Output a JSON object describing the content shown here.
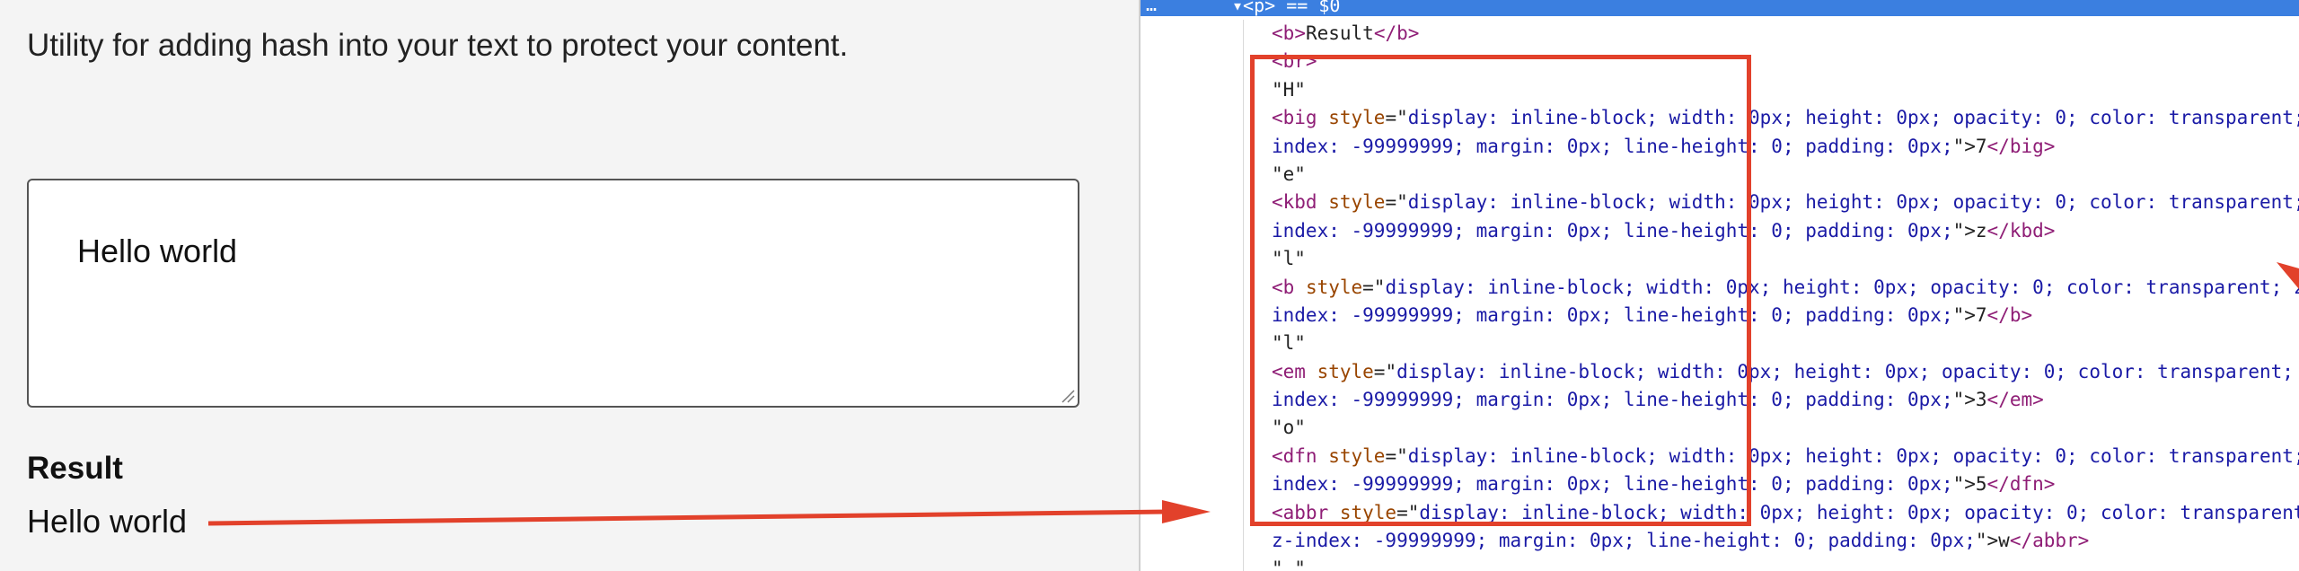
{
  "app": {
    "description": "Utility for adding hash into your text to protect your content.",
    "input_value": "Hello world",
    "result_heading": "Result",
    "result_text": "Hello world"
  },
  "devtools": {
    "ellipsis": "…",
    "selected_node": "▾<p> == $0",
    "lines": [
      [
        {
          "c": "tag",
          "t": "<"
        },
        {
          "c": "tag",
          "t": "b"
        },
        {
          "c": "tag",
          "t": ">"
        },
        {
          "c": "txt",
          "t": "Result"
        },
        {
          "c": "tag",
          "t": "</b>"
        }
      ],
      [
        {
          "c": "tag",
          "t": "<br>"
        }
      ],
      [
        {
          "c": "txt",
          "t": "\"H\""
        }
      ],
      [
        {
          "c": "tag",
          "t": "<big "
        },
        {
          "c": "attr",
          "t": "style"
        },
        {
          "c": "txt",
          "t": "=\""
        },
        {
          "c": "val",
          "t": "display: inline-block; width: 0px; height: 0px; opacity: 0; color: transparent; z-"
        }
      ],
      [
        {
          "c": "val",
          "t": "index: -99999999; margin: 0px; line-height: 0; padding: 0px;"
        },
        {
          "c": "txt",
          "t": "\">"
        },
        {
          "c": "txt",
          "t": "7"
        },
        {
          "c": "tag",
          "t": "</big>"
        }
      ],
      [
        {
          "c": "txt",
          "t": "\"e\""
        }
      ],
      [
        {
          "c": "tag",
          "t": "<kbd "
        },
        {
          "c": "attr",
          "t": "style"
        },
        {
          "c": "txt",
          "t": "=\""
        },
        {
          "c": "val",
          "t": "display: inline-block; width: 0px; height: 0px; opacity: 0; color: transparent; z-"
        }
      ],
      [
        {
          "c": "val",
          "t": "index: -99999999; margin: 0px; line-height: 0; padding: 0px;"
        },
        {
          "c": "txt",
          "t": "\">"
        },
        {
          "c": "txt",
          "t": "z"
        },
        {
          "c": "tag",
          "t": "</kbd>"
        }
      ],
      [
        {
          "c": "txt",
          "t": "\"l\""
        }
      ],
      [
        {
          "c": "tag",
          "t": "<b "
        },
        {
          "c": "attr",
          "t": "style"
        },
        {
          "c": "txt",
          "t": "=\""
        },
        {
          "c": "val",
          "t": "display: inline-block; width: 0px; height: 0px; opacity: 0; color: transparent; z-"
        }
      ],
      [
        {
          "c": "val",
          "t": "index: -99999999; margin: 0px; line-height: 0; padding: 0px;"
        },
        {
          "c": "txt",
          "t": "\">"
        },
        {
          "c": "txt",
          "t": "7"
        },
        {
          "c": "tag",
          "t": "</b>"
        }
      ],
      [
        {
          "c": "txt",
          "t": "\"l\""
        }
      ],
      [
        {
          "c": "tag",
          "t": "<em "
        },
        {
          "c": "attr",
          "t": "style"
        },
        {
          "c": "txt",
          "t": "=\""
        },
        {
          "c": "val",
          "t": "display: inline-block; width: 0px; height: 0px; opacity: 0; color: transparent; z-"
        }
      ],
      [
        {
          "c": "val",
          "t": "index: -99999999; margin: 0px; line-height: 0; padding: 0px;"
        },
        {
          "c": "txt",
          "t": "\">"
        },
        {
          "c": "txt",
          "t": "3"
        },
        {
          "c": "tag",
          "t": "</em>"
        }
      ],
      [
        {
          "c": "txt",
          "t": "\"o\""
        }
      ],
      [
        {
          "c": "tag",
          "t": "<dfn "
        },
        {
          "c": "attr",
          "t": "style"
        },
        {
          "c": "txt",
          "t": "=\""
        },
        {
          "c": "val",
          "t": "display: inline-block; width: 0px; height: 0px; opacity: 0; color: transparent; z-"
        }
      ],
      [
        {
          "c": "val",
          "t": "index: -99999999; margin: 0px; line-height: 0; padding: 0px;"
        },
        {
          "c": "txt",
          "t": "\">"
        },
        {
          "c": "txt",
          "t": "5"
        },
        {
          "c": "tag",
          "t": "</dfn>"
        }
      ],
      [
        {
          "c": "tag",
          "t": "<abbr "
        },
        {
          "c": "attr",
          "t": "style"
        },
        {
          "c": "txt",
          "t": "=\""
        },
        {
          "c": "val",
          "t": "display: inline-block; width: 0px; height: 0px; opacity: 0; color: transparent;"
        }
      ],
      [
        {
          "c": "val",
          "t": "z-index: -99999999; margin: 0px; line-height: 0; padding: 0px;"
        },
        {
          "c": "txt",
          "t": "\">"
        },
        {
          "c": "txt",
          "t": "w"
        },
        {
          "c": "tag",
          "t": "</abbr>"
        }
      ],
      [
        {
          "c": "txt",
          "t": "\" \""
        }
      ]
    ]
  },
  "colors": {
    "annotation": "#e2412b",
    "devtools_selection": "#3b7fe0",
    "tag": "#8f1e76",
    "attribute": "#994500",
    "attribute_value": "#1a1aa6"
  }
}
